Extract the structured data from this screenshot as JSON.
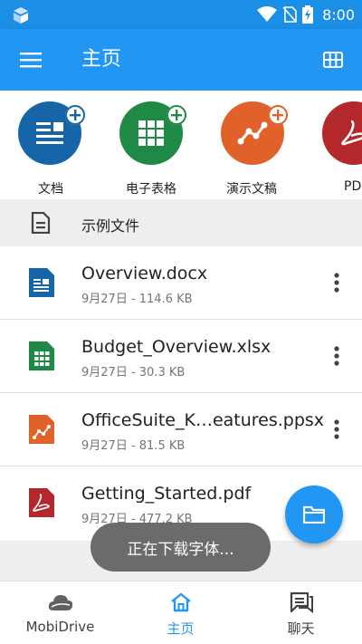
{
  "status_bar": {
    "time": "8:00",
    "icons": [
      "app-logo-icon",
      "wifi-icon",
      "no-sim-icon",
      "battery-charging-icon"
    ]
  },
  "app_bar": {
    "title": "主页",
    "menu_icon": "hamburger-menu-icon",
    "view_icon": "grid-view-icon"
  },
  "quick_create": [
    {
      "label": "文档",
      "color": "#1565a8",
      "icon": "document-icon"
    },
    {
      "label": "电子表格",
      "color": "#1f8a46",
      "icon": "spreadsheet-icon"
    },
    {
      "label": "演示文稿",
      "color": "#e0622a",
      "icon": "presentation-icon"
    },
    {
      "label": "PDF",
      "color": "#b3282a",
      "icon": "pdf-icon"
    }
  ],
  "section": {
    "title": "示例文件",
    "icon": "document-outline-icon"
  },
  "files": [
    {
      "name": "Overview.docx",
      "meta": "9月27日 - 114.6 KB",
      "icon": "docx-file-icon",
      "color": "#1565a8"
    },
    {
      "name": "Budget_Overview.xlsx",
      "meta": "9月27日 - 30.3 KB",
      "icon": "xlsx-file-icon",
      "color": "#1f8a46"
    },
    {
      "name": "OfficeSuite_K…eatures.ppsx",
      "meta": "9月27日 - 81.5 KB",
      "icon": "ppsx-file-icon",
      "color": "#e0622a"
    },
    {
      "name": "Getting_Started.pdf",
      "meta": "9月27日 - 477.2 KB",
      "icon": "pdf-file-icon",
      "color": "#b3282a"
    }
  ],
  "fab": {
    "icon": "folder-icon"
  },
  "toast": {
    "text": "正在下载字体..."
  },
  "bottom_nav": [
    {
      "label": "MobiDrive",
      "icon": "cloud-icon",
      "active": false
    },
    {
      "label": "主页",
      "icon": "home-icon",
      "active": true
    },
    {
      "label": "聊天",
      "icon": "chat-icon",
      "active": false
    }
  ],
  "colors": {
    "primary": "#2196f3",
    "status_bar": "#1b8fe6",
    "section_bg": "#eeeeee"
  }
}
